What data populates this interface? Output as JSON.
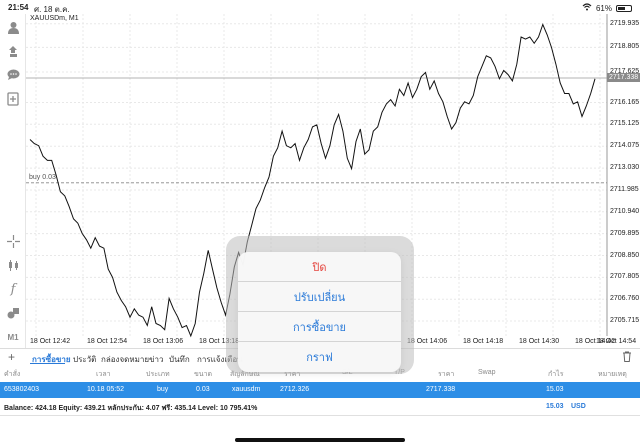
{
  "status_bar": {
    "time": "21:54",
    "date": "ศ. 18 ต.ค.",
    "battery": "61%",
    "battery_level": 0.61
  },
  "chart": {
    "symbol_label": "XAUUSDm, M1",
    "buy_label": "buy 0.03",
    "current_price": "2717.338"
  },
  "chart_data": {
    "type": "line",
    "title": "XAUUSDm, M1",
    "xlabel": "",
    "ylabel": "",
    "ylim": [
      2705.0,
      2720.4
    ],
    "grid": true,
    "y_ticks": [
      "2719.935",
      "2718.805",
      "2717.625",
      "2716.165",
      "2715.125",
      "2714.075",
      "2713.030",
      "2711.985",
      "2710.940",
      "2709.895",
      "2708.850",
      "2707.805",
      "2706.760",
      "2705.715"
    ],
    "x_ticks": [
      "18 Oct 12:42",
      "18 Oct 12:54",
      "18 Oct 13:06",
      "18 Oct 13:18",
      "18 Oct 14:06",
      "18 Oct 14:18",
      "18 Oct 14:30",
      "18 Oct 14:42",
      "18 Oct 14:54"
    ],
    "series": [
      {
        "values": [
          2714.4,
          2714.2,
          2714.1,
          2713.6,
          2713.4,
          2713.4,
          2712.7,
          2711.9,
          2711.7,
          2711.2,
          2710.6,
          2710.4,
          2709.9,
          2709.6,
          2709.2,
          2709.7,
          2709.3,
          2709.2,
          2708.2,
          2707.8,
          2707.1,
          2706.7,
          2706.4,
          2705.9,
          2706.3,
          2706.0,
          2705.9,
          2705.5,
          2706.4,
          2705.6,
          2705.5,
          2705.3,
          2706.8,
          2706.3,
          2705.9,
          2705.4,
          2705.5,
          2705.0,
          2705.6,
          2707.1,
          2708.0,
          2709.1,
          2708.2,
          2707.3,
          2706.6,
          2706.0,
          2707.0,
          2708.3,
          2709.0,
          2708.4,
          2709.5,
          2710.3,
          2711.1,
          2711.5,
          2712.1,
          2712.6,
          2713.6,
          2714.0,
          2714.8,
          2714.1,
          2714.0,
          2714.2,
          2713.4,
          2714.0,
          2714.4,
          2715.0,
          2715.1,
          2714.2,
          2713.5,
          2714.1,
          2715.1,
          2715.6,
          2714.8,
          2713.5,
          2713.0,
          2714.3,
          2714.9,
          2713.7,
          2713.9,
          2714.8,
          2715.0,
          2715.7,
          2716.1,
          2716.3,
          2716.0,
          2716.8,
          2716.5,
          2717.1,
          2716.4,
          2716.8,
          2717.4,
          2717.6,
          2716.8,
          2717.2,
          2716.6,
          2716.2,
          2715.5,
          2714.9,
          2715.2,
          2715.9,
          2716.2,
          2716.1,
          2716.5,
          2717.4,
          2717.9,
          2718.4,
          2718.3,
          2717.9,
          2717.3,
          2717.7,
          2717.5,
          2717.2,
          2718.0,
          2719.3,
          2719.2,
          2719.3,
          2719.0,
          2719.3,
          2719.9,
          2719.4,
          2718.8,
          2718.0,
          2717.1,
          2716.6,
          2716.6,
          2716.1,
          2716.2,
          2715.5,
          2716.0,
          2716.6,
          2717.3
        ]
      }
    ]
  },
  "tabs": [
    "การซื้อขาย",
    "ประวัติ",
    "กล่องจดหมาย",
    "ข่าว",
    "บันทึก",
    "การแจ้งเตือน"
  ],
  "table": {
    "headers": [
      "คำสั่ง",
      "เวลา",
      "ประเภท",
      "ขนาด",
      "สัญลักษณ์",
      "ราคา",
      "S/L",
      "T/P",
      "ราคา",
      "Swap",
      "กำไร",
      "หมายเหตุ"
    ],
    "row": [
      "653802403",
      "10.18 05:52",
      "buy",
      "0.03",
      "xauusdm",
      "2712.326",
      "",
      "",
      "2717.338",
      "",
      "15.03",
      ""
    ]
  },
  "balance": {
    "text": "Balance: 424.18 Equity: 439.21 หลักประกัน: 4.07 ฟรี: 435.14 Level: 10 795.41%",
    "profit": "15.03",
    "currency": "USD"
  },
  "menu": {
    "close": "ปิด",
    "modify": "ปรับเปลี่ยน",
    "trade": "การซื้อขาย",
    "chart": "กราฟ"
  },
  "colors": {
    "accent": "#2a7ad8",
    "danger": "#e5463f",
    "row_highlight": "#2d8ee6"
  },
  "icons": [
    "user-icon",
    "transfer-icon",
    "chat-icon",
    "add-document-icon",
    "crosshair-icon",
    "candles-icon",
    "function-icon",
    "shapes-icon",
    "timeframe-icon",
    "plus-icon",
    "trash-icon",
    "wifi-icon",
    "battery-icon"
  ]
}
